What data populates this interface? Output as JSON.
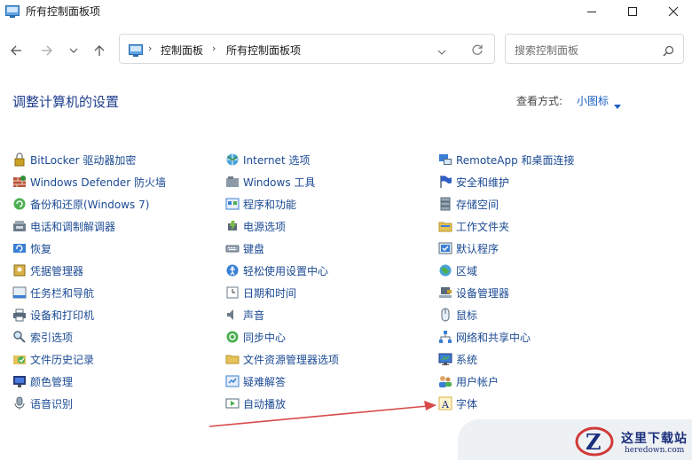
{
  "window": {
    "title": "所有控制面板项"
  },
  "address": {
    "crumbs": [
      "控制面板",
      "所有控制面板项"
    ]
  },
  "search": {
    "placeholder": "搜索控制面板"
  },
  "header": {
    "title": "调整计算机的设置",
    "view_label": "查看方式:",
    "view_value": "小图标"
  },
  "columns": [
    [
      {
        "label": "BitLocker 驱动器加密",
        "icon": "bitlocker-icon"
      },
      {
        "label": "Windows Defender 防火墙",
        "icon": "firewall-icon"
      },
      {
        "label": "备份和还原(Windows 7)",
        "icon": "backup-icon"
      },
      {
        "label": "电话和调制解调器",
        "icon": "phone-modem-icon"
      },
      {
        "label": "恢复",
        "icon": "recovery-icon"
      },
      {
        "label": "凭据管理器",
        "icon": "credential-icon"
      },
      {
        "label": "任务栏和导航",
        "icon": "taskbar-icon"
      },
      {
        "label": "设备和打印机",
        "icon": "printer-icon"
      },
      {
        "label": "索引选项",
        "icon": "indexing-icon"
      },
      {
        "label": "文件历史记录",
        "icon": "file-history-icon"
      },
      {
        "label": "颜色管理",
        "icon": "color-management-icon"
      },
      {
        "label": "语音识别",
        "icon": "microphone-icon"
      }
    ],
    [
      {
        "label": "Internet 选项",
        "icon": "internet-icon"
      },
      {
        "label": "Windows 工具",
        "icon": "tools-icon"
      },
      {
        "label": "程序和功能",
        "icon": "programs-icon"
      },
      {
        "label": "电源选项",
        "icon": "power-icon"
      },
      {
        "label": "键盘",
        "icon": "keyboard-icon"
      },
      {
        "label": "轻松使用设置中心",
        "icon": "accessibility-icon"
      },
      {
        "label": "日期和时间",
        "icon": "clock-icon"
      },
      {
        "label": "声音",
        "icon": "sound-icon"
      },
      {
        "label": "同步中心",
        "icon": "sync-icon"
      },
      {
        "label": "文件资源管理器选项",
        "icon": "folder-options-icon"
      },
      {
        "label": "疑难解答",
        "icon": "troubleshoot-icon"
      },
      {
        "label": "自动播放",
        "icon": "autoplay-icon"
      }
    ],
    [
      {
        "label": "RemoteApp 和桌面连接",
        "icon": "remoteapp-icon"
      },
      {
        "label": "安全和维护",
        "icon": "flag-icon"
      },
      {
        "label": "存储空间",
        "icon": "storage-icon"
      },
      {
        "label": "工作文件夹",
        "icon": "work-folders-icon"
      },
      {
        "label": "默认程序",
        "icon": "default-programs-icon"
      },
      {
        "label": "区域",
        "icon": "region-icon"
      },
      {
        "label": "设备管理器",
        "icon": "device-manager-icon"
      },
      {
        "label": "鼠标",
        "icon": "mouse-icon"
      },
      {
        "label": "网络和共享中心",
        "icon": "network-icon"
      },
      {
        "label": "系统",
        "icon": "system-icon"
      },
      {
        "label": "用户帐户",
        "icon": "user-accounts-icon"
      },
      {
        "label": "字体",
        "icon": "font-icon"
      }
    ]
  ],
  "watermark": {
    "title": "这里下载站",
    "url": "heredown.com"
  },
  "colors": {
    "link": "#1b4a93",
    "title": "#1f3e8c",
    "accent": "#1b5fc4",
    "arrow": "#d84a4a"
  }
}
